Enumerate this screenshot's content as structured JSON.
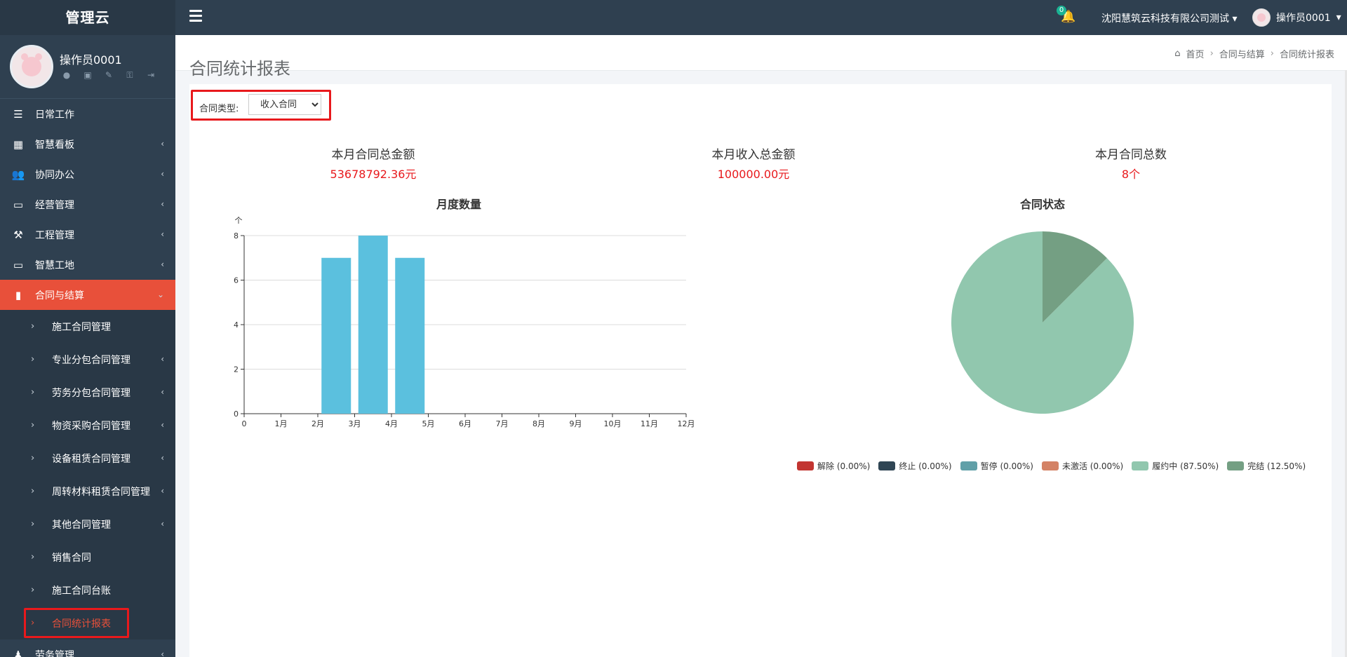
{
  "app": {
    "brand": "管理云"
  },
  "profile": {
    "username": "操作员0001",
    "icons": [
      "user-icon",
      "id-card-icon",
      "edit-icon",
      "key-icon",
      "logout-icon"
    ]
  },
  "menu": [
    {
      "label": "日常工作",
      "icon": "indent-icon",
      "has_children": false
    },
    {
      "label": "智慧看板",
      "icon": "dashboard-icon",
      "has_children": true
    },
    {
      "label": "协同办公",
      "icon": "users-icon",
      "has_children": true
    },
    {
      "label": "经营管理",
      "icon": "desktop-icon",
      "has_children": true
    },
    {
      "label": "工程管理",
      "icon": "gavel-icon",
      "has_children": true
    },
    {
      "label": "智慧工地",
      "icon": "desktop-icon",
      "has_children": true
    },
    {
      "label": "合同与结算",
      "icon": "file-icon",
      "has_children": true,
      "active": true
    }
  ],
  "submenu": [
    {
      "label": "施工合同管理",
      "has_children": false
    },
    {
      "label": "专业分包合同管理",
      "has_children": true
    },
    {
      "label": "劳务分包合同管理",
      "has_children": true
    },
    {
      "label": "物资采购合同管理",
      "has_children": true
    },
    {
      "label": "设备租赁合同管理",
      "has_children": true
    },
    {
      "label": "周转材料租赁合同管理",
      "has_children": true
    },
    {
      "label": "其他合同管理",
      "has_children": true
    },
    {
      "label": "销售合同",
      "has_children": false
    },
    {
      "label": "施工合同台账",
      "has_children": false
    },
    {
      "label": "合同统计报表",
      "has_children": false,
      "current": true
    }
  ],
  "menu_after": {
    "label": "劳务管理",
    "icon": "worker-icon",
    "has_children": true
  },
  "topbar": {
    "notification_count": "0",
    "company": "沈阳慧筑云科技有限公司测试",
    "user": "操作员0001"
  },
  "page": {
    "title": "合同统计报表",
    "breadcrumb": [
      "首页",
      "合同与结算",
      "合同统计报表"
    ]
  },
  "filter": {
    "label": "合同类型:",
    "selected": "收入合同",
    "options": [
      "收入合同"
    ]
  },
  "stats": [
    {
      "label": "本月合同总金额",
      "value": "53678792.36元"
    },
    {
      "label": "本月收入总金额",
      "value": "100000.00元"
    },
    {
      "label": "本月合同总数",
      "value": "8个"
    }
  ],
  "colors": {
    "bar": "#5bc0de",
    "accent": "#e8503a",
    "highlight": "#e8191c"
  },
  "chart_data": [
    {
      "type": "bar",
      "title": "月度数量",
      "ylabel": "个",
      "categories": [
        "1月",
        "2月",
        "3月",
        "4月",
        "5月",
        "6月",
        "7月",
        "8月",
        "9月",
        "10月",
        "11月",
        "12月"
      ],
      "values": [
        0,
        0,
        7,
        8,
        7,
        0,
        0,
        0,
        0,
        0,
        0,
        0
      ],
      "x_ticks": [
        "0",
        "1月",
        "2月",
        "3月",
        "4月",
        "5月",
        "6月",
        "7月",
        "8月",
        "9月",
        "10月",
        "11月",
        "12月"
      ],
      "y_ticks": [
        "0",
        "2",
        "4",
        "6",
        "8"
      ],
      "ylim": [
        0,
        8
      ],
      "grid": true
    },
    {
      "type": "pie",
      "title": "合同状态",
      "legend_position": "bottom",
      "slices": [
        {
          "label": "解除",
          "percent_label": "(0.00%)",
          "value": 0,
          "color": "#c23531"
        },
        {
          "label": "终止",
          "percent_label": "(0.00%)",
          "value": 0,
          "color": "#2f4554"
        },
        {
          "label": "暂停",
          "percent_label": "(0.00%)",
          "value": 0,
          "color": "#61a0a8"
        },
        {
          "label": "未激活",
          "percent_label": "(0.00%)",
          "value": 0,
          "color": "#d48265"
        },
        {
          "label": "履约中",
          "percent_label": "(87.50%)",
          "value": 87.5,
          "color": "#91c7ae"
        },
        {
          "label": "完结",
          "percent_label": "(12.50%)",
          "value": 12.5,
          "color": "#749f83"
        }
      ]
    }
  ]
}
